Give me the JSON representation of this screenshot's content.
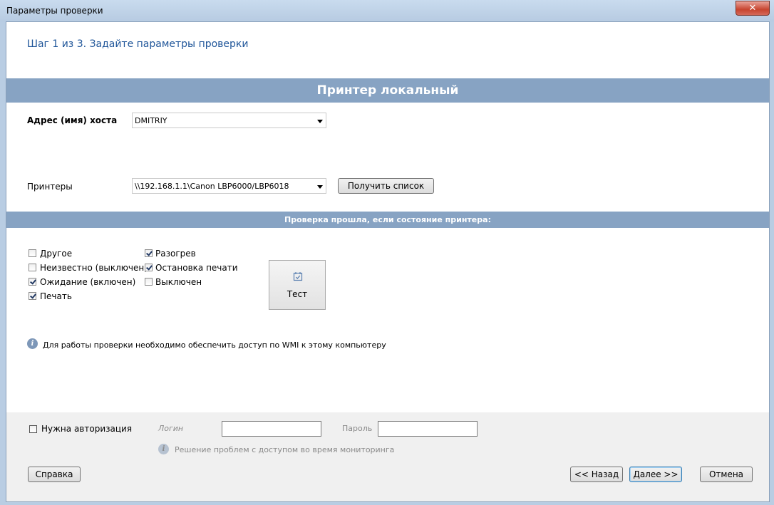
{
  "window": {
    "title": "Параметры проверки",
    "close_glyph": "✕"
  },
  "header": {
    "step": "Шаг 1 из 3. Задайте параметры проверки"
  },
  "section": {
    "title": "Принтер локальный"
  },
  "host": {
    "label": "Адрес (имя) хоста",
    "value": "DMITRIY"
  },
  "printers": {
    "label": "Принтеры",
    "value": "\\\\192.168.1.1\\Canon LBP6000/LBP6018",
    "get_list": "Получить список"
  },
  "status": {
    "title": "Проверка прошла, если состояние принтера:",
    "col1": [
      {
        "label": "Другое",
        "checked": false
      },
      {
        "label": "Неизвестно (выключен)",
        "checked": false
      },
      {
        "label": "Ожидание (включен)",
        "checked": true
      },
      {
        "label": "Печать",
        "checked": true
      }
    ],
    "col2": [
      {
        "label": "Разогрев",
        "checked": true
      },
      {
        "label": "Остановка печати",
        "checked": true
      },
      {
        "label": "Выключен",
        "checked": false
      }
    ]
  },
  "test_button": {
    "label": "Тест",
    "icon": "calendar-check-icon"
  },
  "info": {
    "text": "Для работы проверки необходимо обеспечить доступ по WMI к этому компьютеру"
  },
  "auth": {
    "checkbox_label": "Нужна авторизация",
    "checked": false,
    "login_label": "Логин",
    "login_value": "",
    "password_label": "Пароль",
    "password_value": "",
    "help_link": "Решение проблем с доступом во время мониторинга"
  },
  "buttons": {
    "help": "Справка",
    "back": "<< Назад",
    "next": "Далее >>",
    "cancel": "Отмена"
  },
  "colors": {
    "accent_bar": "#87a3c3",
    "step_text": "#1f5599"
  }
}
